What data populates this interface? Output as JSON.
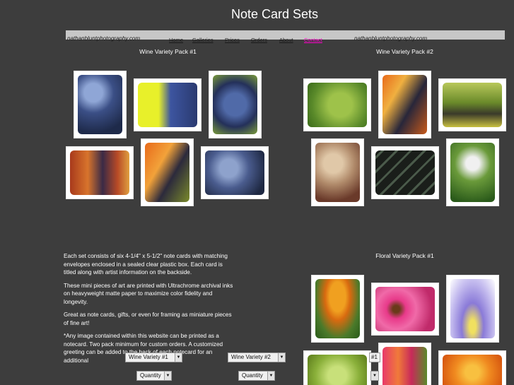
{
  "page": {
    "title": "Note Card Sets"
  },
  "header": {
    "site_left": "nathanbluntphotography.com",
    "site_right": "nathanbluntphotography.com",
    "nav": [
      {
        "label": "Home"
      },
      {
        "label": "Galleries"
      },
      {
        "label": "Prices"
      },
      {
        "label": "Orders"
      },
      {
        "label": "About"
      },
      {
        "label": "Contact"
      }
    ]
  },
  "packs": {
    "wine1": {
      "title": "Wine Variety Pack #1"
    },
    "wine2": {
      "title": "Wine Variety Pack #2"
    },
    "floral1": {
      "title": "Floral Variety Pack #1"
    }
  },
  "description": {
    "p1": "Each set consists of six 4-1/4\" x 5-1/2\" note cards with matching envelopes enclosed in a sealed clear plastic box. Each card is titled along with artist information on the backside.",
    "p2": "These mini pieces of art are printed with Ultrachrome archival inks on heavyweight matte paper to maximize color fidelity and longevity.",
    "p3": "Great as note cards, gifts, or even for framing as miniature pieces of fine art!",
    "p4": "*Any image contained within this website can be printed as a notecard. Two pack minimum for custom orders. A customized greeting can be added to the back of each notecard for an additional"
  },
  "selects": {
    "pack_a": "Wine Variety #1",
    "qty_a": "Quantity",
    "pack_b": "Wine Variety #2",
    "qty_b": "Quantity",
    "pack_c_fragment": "#1"
  },
  "colors": {
    "background": "#3d3d3d",
    "navbar": "#c7c7c7",
    "active_link": "#ff00cc"
  }
}
